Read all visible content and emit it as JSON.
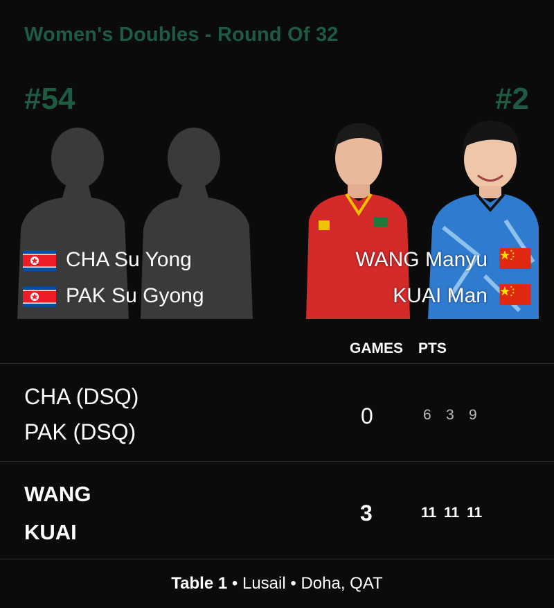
{
  "header": {
    "title": "Women's Doubles - Round Of 32"
  },
  "team_left": {
    "rank": "#54",
    "players": [
      {
        "name": "CHA Su Yong",
        "flag": "north-korea-flag-icon"
      },
      {
        "name": "PAK Su Gyong",
        "flag": "north-korea-flag-icon"
      }
    ]
  },
  "team_right": {
    "rank": "#2",
    "players": [
      {
        "name": "WANG Manyu",
        "flag": "china-flag-icon"
      },
      {
        "name": "KUAI Man",
        "flag": "china-flag-icon"
      }
    ]
  },
  "scoreboard": {
    "games_label": "GAMES",
    "pts_label": "PTS",
    "rows": [
      {
        "line1": "CHA (DSQ)",
        "line2": "PAK (DSQ)",
        "games": "0",
        "points": [
          "6",
          "3",
          "9"
        ]
      },
      {
        "line1": "WANG",
        "line2": "KUAI",
        "games": "3",
        "points": [
          "11",
          "11",
          "11"
        ]
      }
    ]
  },
  "footer": {
    "table": "Table 1",
    "sep1": " • ",
    "venue": "Lusail",
    "sep2": " • ",
    "location": "Doha, QAT"
  },
  "colors": {
    "accent": "#1f5a43",
    "background": "#0b0b0b",
    "silhouette": "#3a3a3a",
    "china_red": "#de2910",
    "nk_blue": "#024fa2",
    "nk_red": "#ed1c27"
  }
}
